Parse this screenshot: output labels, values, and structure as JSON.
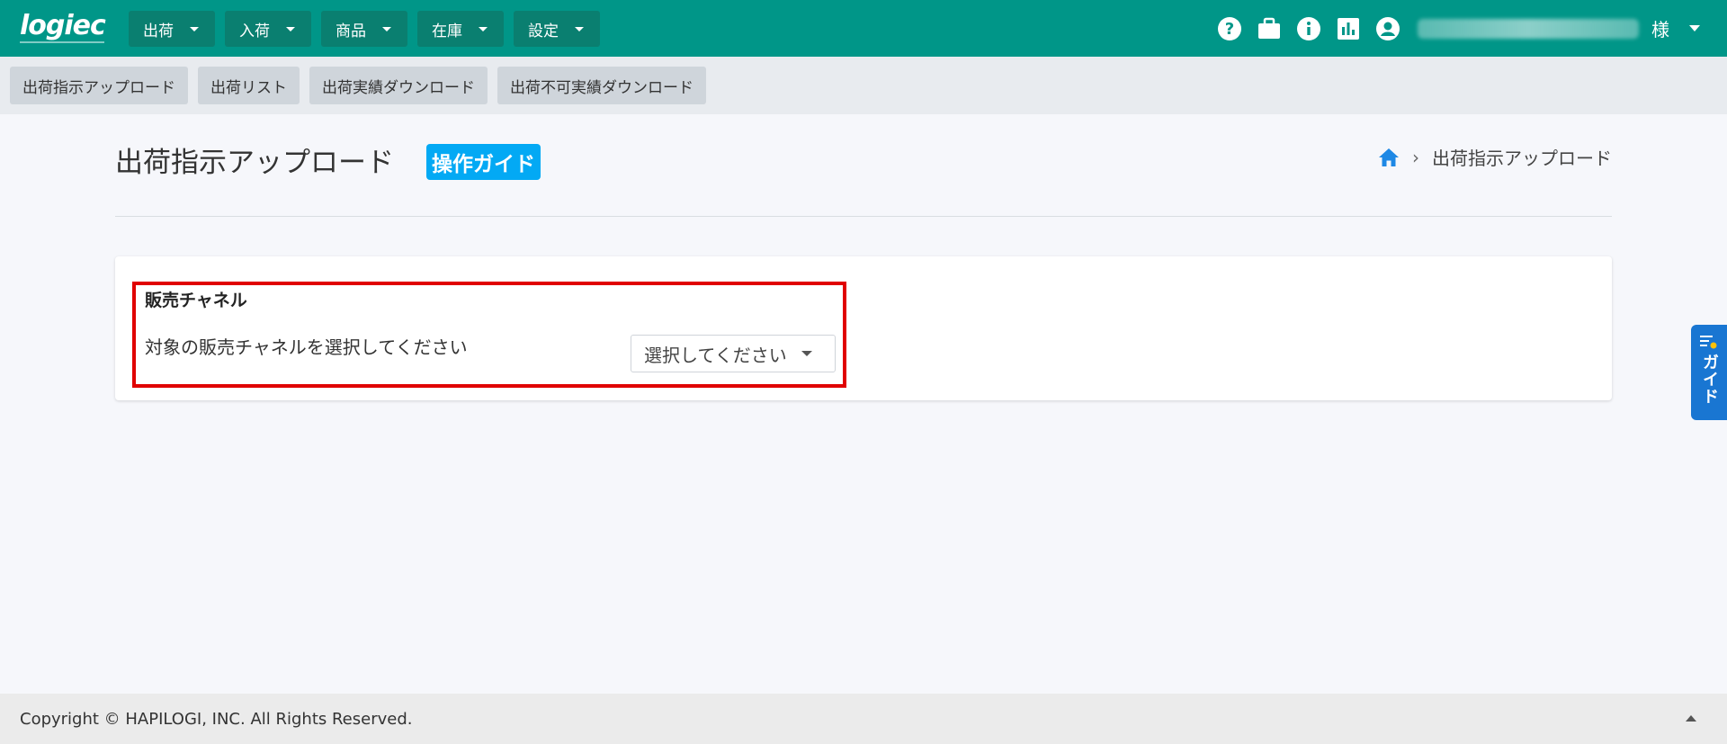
{
  "header": {
    "logo": "logiec",
    "menus": [
      {
        "label": "出荷"
      },
      {
        "label": "入荷"
      },
      {
        "label": "商品"
      },
      {
        "label": "在庫"
      },
      {
        "label": "設定"
      }
    ],
    "icons": [
      "help-icon",
      "briefcase-icon",
      "info-icon",
      "chart-icon",
      "account-icon"
    ],
    "user_suffix": "様"
  },
  "subnav": {
    "items": [
      {
        "label": "出荷指示アップロード"
      },
      {
        "label": "出荷リスト"
      },
      {
        "label": "出荷実績ダウンロード"
      },
      {
        "label": "出荷不可実績ダウンロード"
      }
    ]
  },
  "page": {
    "title": "出荷指示アップロード",
    "guide_badge": "操作ガイド",
    "breadcrumb": {
      "current": "出荷指示アップロード"
    }
  },
  "card": {
    "section_title": "販売チャネル",
    "field_label": "対象の販売チャネルを選択してください",
    "select_value": "選択してください"
  },
  "side_guide": {
    "label": "ガイド"
  },
  "footer": {
    "copyright": "Copyright © HAPILOGI, INC. All Rights Reserved."
  },
  "colors": {
    "header_bg": "#009688",
    "accent_blue": "#03a9f4",
    "highlight_red": "#e00000",
    "side_guide_bg": "#1976d2"
  }
}
